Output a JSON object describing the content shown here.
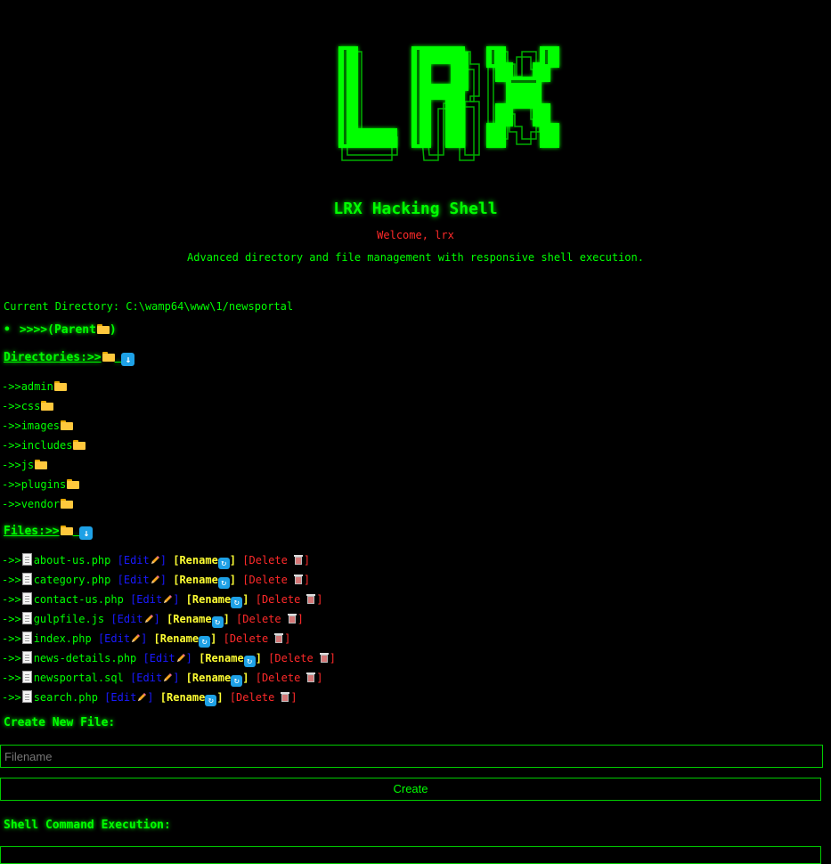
{
  "logo": {
    "text": "LRX"
  },
  "header": {
    "title": "LRX Hacking Shell",
    "welcome": "Welcome, lrx",
    "tagline": "Advanced directory and file management with responsive shell execution."
  },
  "current_directory": "Current Directory: C:\\wamp64\\www\\1/newsportal",
  "parent_link": {
    "bullet": "•",
    "label": ">>>>(Parent",
    "close": ")"
  },
  "directories": {
    "heading": "Directories:>>",
    "prefix": "->>",
    "items": [
      "admin",
      "css",
      "images",
      "includes",
      "js",
      "plugins",
      "vendor"
    ]
  },
  "files": {
    "heading": "Files:>>",
    "prefix": "->>",
    "edit_label": "[Edit",
    "rename_label": "[Rename",
    "delete_label": "[Delete",
    "close_bracket": "]",
    "items": [
      "about-us.php",
      "category.php",
      "contact-us.php",
      "gulpfile.js",
      "index.php",
      "news-details.php",
      "newsportal.sql",
      "search.php"
    ]
  },
  "create_file": {
    "heading": "Create New File:",
    "placeholder": "Filename",
    "button_label": "Create"
  },
  "shell": {
    "heading": "Shell Command Execution:"
  },
  "colors": {
    "accent": "#00ff00",
    "danger": "#ff2a2a",
    "edit": "#1a1aff",
    "rename": "#ffff33"
  },
  "icons": {
    "folder": "folder-icon",
    "download": "arrow-down-icon",
    "file": "document-icon",
    "edit": "pencil-icon",
    "rename": "refresh-icon",
    "delete": "trash-icon"
  }
}
